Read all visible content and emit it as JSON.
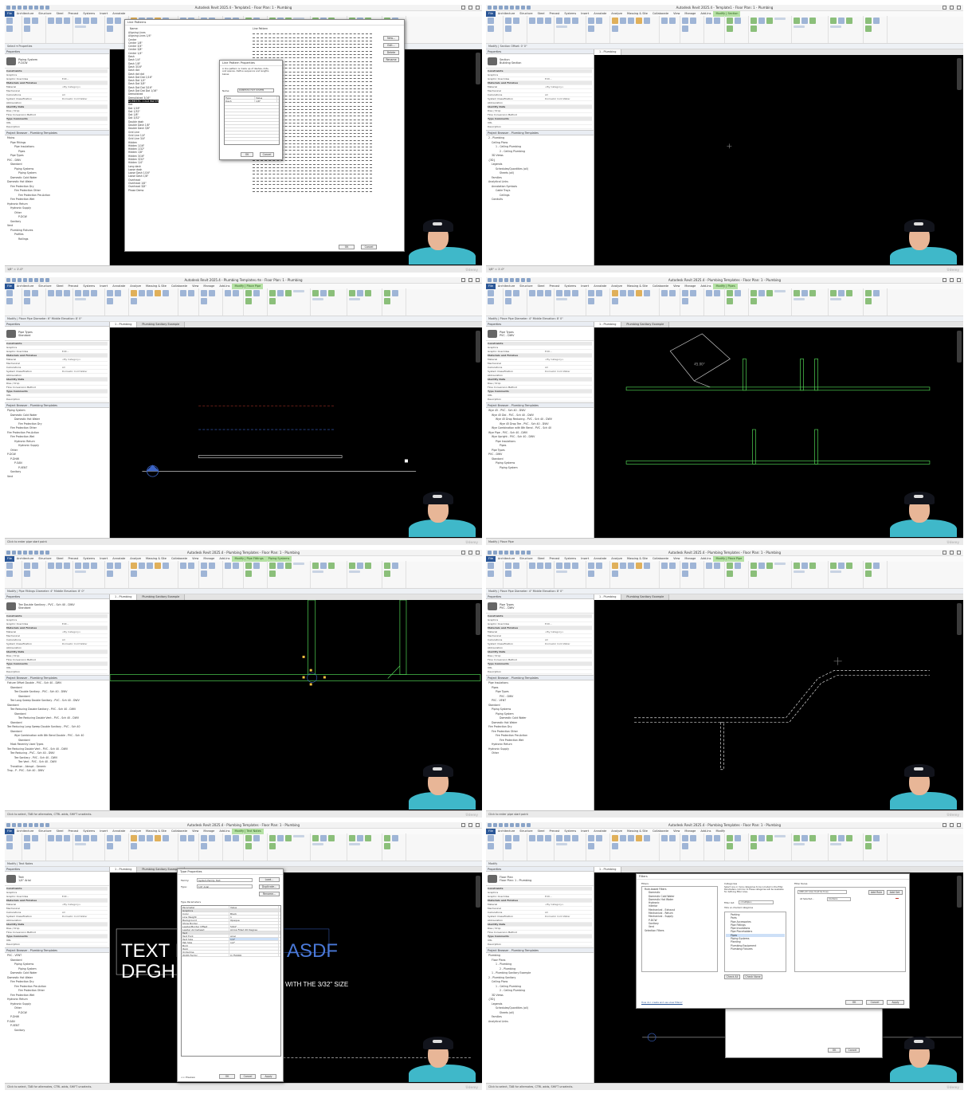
{
  "panels": [
    {
      "title": "Autodesk Revit 2025.4 - Template1 - Floor Plan: 1 - Plumbing",
      "tabs": [
        "File",
        "Architecture",
        "Structure",
        "Steel",
        "Precast",
        "Systems",
        "Insert",
        "Annotate"
      ],
      "options_bar": "Select ▾  Properties",
      "type_name": "Piping System",
      "type_sub": "P-DCW",
      "status": "1/8\" = 1'-0\"",
      "dialog_title": "Line Patterns",
      "dialog_col_name": "Name:",
      "dialog_col_pattern": "Line Pattern",
      "dialog_items": [
        "Aligning Lines",
        "Aligning Lines 1/4\"",
        "Center",
        "Center 1/8\"",
        "Center 3/4\"",
        "Center 3/8\"",
        "Center 1/4\"",
        "Dash",
        "Dash 1/4\"",
        "Dash 1/8\"",
        "Dash 3/16\"",
        "Dash dot",
        "Dash dot dot",
        "Dash Dot Dot 1/16\"",
        "Dash Dot 1/4\"",
        "Dash Dot 3/8\"",
        "Dash Dot Dot 3/16\"",
        "Dash Dot Dot Dot 1/16\"",
        "Demolished",
        "Demolished 3/16\"",
        "DOMESTIC COLD WATER",
        "Dot",
        "Dot 1/16\"",
        "Dot 1/32\"",
        "Dot 1/8\"",
        "Dot 3/32\"",
        "Double dash",
        "Double Dash 1/8\"",
        "Double Dash 3/8\"",
        "Grid Line",
        "Grid Line 1/4\"",
        "Grid Line 3/4\"",
        "Hidden",
        "Hidden 1/16\"",
        "Hidden 1/32\"",
        "Hidden 1/8\"",
        "Hidden 3/16\"",
        "Hidden 3/32\"",
        "Hidden 1/4\"",
        "Long dash",
        "Loose dash",
        "Loose Dash 1/16\"",
        "Loose Dash 1/8\"",
        "Overhead",
        "Overhead 1/8\"",
        "Overhead 3/8\"",
        "Phase Demo"
      ],
      "dialog_buttons": [
        "New...",
        "Edit...",
        "Delete",
        "Rename"
      ],
      "ok": "OK",
      "cancel": "Cancel",
      "sub_title": "Line Pattern Properties",
      "sub_text": "A line pattern is made up of dashes, dots, and spaces. Define sequence and lengths below.",
      "sub_name_label": "Name:",
      "sub_name_value": "DOMESTIC HOT SYSTEM",
      "sub_col_type": "Type",
      "sub_col_value": "Value",
      "sub_row1_type": "Dash",
      "sub_row1_value": "1/8\"",
      "tree": [
        "Mains",
        "Pipe Fittings",
        "Pipe Insulations",
        "Pipes",
        "Pipe Types",
        "PVC - DWV",
        "Standard",
        "Piping Systems",
        "Piping System",
        "Domestic Cold Water",
        "Domestic Hot Water",
        "Fire Protection Dry",
        "Fire Protection Other",
        "Fire Protection Pre-Action",
        "Fire Protection Wet",
        "Hydronic Return",
        "Hydronic Supply",
        "Other",
        "P-DCW",
        "Sanitary",
        "Vent",
        "Plumbing Fixtures",
        "Profiles",
        "Railings"
      ]
    },
    {
      "title": "Autodesk Revit 2025.4 - Template1 - Floor Plan: 1 - Plumbing",
      "tabs": [
        "File",
        "Architecture",
        "Structure",
        "Steel",
        "Precast",
        "Systems",
        "Insert",
        "Annotate",
        "Analyze",
        "Massing & Site",
        "Collaborate",
        "View",
        "Manage",
        "Add-Ins",
        "Modify | Section"
      ],
      "options_bar": "Modify | Section  Offset: 0' 0\"",
      "type_name": "Section",
      "type_sub": "Building Section",
      "status": "1/8\" = 1'-0\"",
      "view_tab": "1 - Plumbing",
      "tree": [
        "2 - Plumbing",
        "Ceiling Plans",
        "1 - Ceiling Plumbing",
        "2 - Ceiling Plumbing",
        "3D Views",
        "{3D}",
        "Legends",
        "Schedules/Quantities (all)",
        "Sheets (all)",
        "Families",
        "Analytical Links",
        "Annotation Symbols",
        "Cable Trays",
        "Ceilings",
        "Conduits"
      ]
    },
    {
      "title": "Autodesk Revit 2025.4 - Plumbing Templates.rte - Floor Plan: 1 - Plumbing",
      "tabs": [
        "File",
        "Architecture",
        "Structure",
        "Steel",
        "Precast",
        "Systems",
        "Insert",
        "Annotate",
        "Analyze",
        "Massing & Site",
        "Collaborate",
        "View",
        "Manage",
        "Add-Ins",
        "Modify | Place Pipe"
      ],
      "options_bar": "Modify | Place Pipe   Diameter: 6\"   Middle Elevation: 8' 0\"",
      "type_name": "Pipe Types",
      "type_sub": "Standard",
      "status": "Click to enter pipe start point",
      "view_tab": "1 - Plumbing",
      "view_tab2": "Plumbing Sanitary Example",
      "tree": [
        "Piping System",
        "Domestic Cold Water",
        "Domestic Hot Water",
        "Fire Protection Dry",
        "Fire Protection Other",
        "Fire Protection Pre-Action",
        "Fire Protection Wet",
        "Hydronic Return",
        "Hydronic Supply",
        "Other",
        "P-DCW",
        "P-DHW",
        "P-SAN",
        "P-VENT",
        "Sanitary",
        "Vent"
      ]
    },
    {
      "title": "Autodesk Revit 2025.4 - Plumbing Templates - Floor Plan: 1 - Plumbing",
      "tabs": [
        "File",
        "Architecture",
        "Structure",
        "Steel",
        "Precast",
        "Systems",
        "Insert",
        "Annotate",
        "Analyze",
        "Massing & Site",
        "Collaborate",
        "View",
        "Manage",
        "Add-Ins",
        "Modify | Pipes"
      ],
      "options_bar": "Modify | Place Pipe   Diameter: 4\"   Middle Elevation: 8' 0\"",
      "type_name": "Pipe Types",
      "type_sub": "PVC - DWV",
      "status": "Modify | Place Pipe",
      "view_tab": "1 - Plumbing",
      "view_tab2": "Plumbing Sanitary Example",
      "tree": [
        "Wye 45 - PVC - Sch 40 - DWV",
        "Wye 45 Dbl - PVC - Sch 40 - DWV",
        "Wye 45 Drop Reducing - PVC - Sch 40 - DWV",
        "Wye 45 Drop Tee - PVC - Sch 40 - DWV",
        "Wye Combination with 8th Bend - PVC - Sch 40",
        "Wye Pipe - PVC - Sch 40 - DWV",
        "Wye Upright - PVC - Sch 40 - DWV",
        "Pipe Insulations",
        "Pipes",
        "Pipe Types",
        "PVC - DWV",
        "Standard",
        "Piping Systems",
        "Piping System"
      ]
    },
    {
      "title": "Autodesk Revit 2025.4 - Plumbing Templates - Floor Plan: 1 - Plumbing",
      "tabs": [
        "File",
        "Architecture",
        "Structure",
        "Steel",
        "Precast",
        "Systems",
        "Insert",
        "Annotate",
        "Analyze",
        "Massing & Site",
        "Collaborate",
        "View",
        "Manage",
        "Add-Ins",
        "Modify | Pipe Fittings",
        "Piping Systems"
      ],
      "options_bar": "Modify | Pipe Fittings   Diameter: 4\"   Middle Elevation: 8' 0\"",
      "type_name": "Tee Double Sanitary - PVC - Sch 40 - DWV",
      "type_sub": "Standard",
      "status": "Click to select, TAB for alternates, CTRL adds, SHIFT unselects.",
      "view_tab": "1 - Plumbing",
      "view_tab2": "Plumbing Sanitary Example",
      "tree": [
        "Fixture Offset Double - PVC - Sch 40 - DWV",
        "Standard",
        "Tee Double Sanitary - PVC - Sch 40 - DWV",
        "Standard",
        "Tee Long Sweep Double Sanitary - PVC - Sch 40 - DWV",
        "Standard",
        "Tee Reducing Double Sanitary - PVC - Sch 40 - DWV",
        "Standard",
        "Tee Reducing Double Vent - PVC - Sch 40 - DWV",
        "Standard",
        "Tee Reducing Long Sweep Double Sanitary - PVC - Sch 40",
        "Standard",
        "Wye Combination with 8th Bend Double - PVC - Sch 40",
        "Standard",
        "Most Recently Used Types",
        "Tee Reducing Double Vent - PVC - Sch 40 - DWV",
        "Tee Reducing - PVC - Sch 40 - DWV",
        "Tee Sanitary - PVC - Sch 40 - DWV",
        "Tee Vent - PVC - Sch 40 - DWV",
        "Transition - Abrupt - Generic",
        "Trap - P - PVC - Sch 40 - DWV"
      ]
    },
    {
      "title": "Autodesk Revit 2025.4 - Plumbing Templates - Floor Plan: 1 - Plumbing",
      "tabs": [
        "File",
        "Architecture",
        "Structure",
        "Steel",
        "Precast",
        "Systems",
        "Insert",
        "Annotate",
        "Analyze",
        "Massing & Site",
        "Collaborate",
        "View",
        "Manage",
        "Add-Ins",
        "Modify | Place Pipe"
      ],
      "options_bar": "Modify | Place Pipe   Diameter: 4\"   Middle Elevation: 8' 0\"",
      "type_name": "Pipe Types",
      "type_sub": "PVC - DWV",
      "status": "Click to enter pipe start point",
      "view_tab": "1 - Plumbing",
      "view_tab2": "Plumbing Sanitary Example",
      "tree": [
        "Pipe Insulations",
        "Pipes",
        "Pipe Types",
        "PVC - DWV",
        "PVC - VENT",
        "Standard",
        "Piping Systems",
        "Piping System",
        "Domestic Cold Water",
        "Domestic Hot Water",
        "Fire Protection Dry",
        "Fire Protection Other",
        "Fire Protection Pre-Action",
        "Fire Protection Wet",
        "Hydronic Return",
        "Hydronic Supply",
        "Other"
      ]
    },
    {
      "title": "Autodesk Revit 2025.4 - Plumbing Templates - Floor Plan: 1 - Plumbing",
      "tabs": [
        "File",
        "Architecture",
        "Structure",
        "Steel",
        "Precast",
        "Systems",
        "Insert",
        "Annotate",
        "Analyze",
        "Massing & Site",
        "Collaborate",
        "View",
        "Manage",
        "Add-Ins",
        "Modify | Text Notes"
      ],
      "options_bar": "Modify | Text Notes",
      "type_name": "Text",
      "type_sub": "1/4\" Arial",
      "status": "Click to select, TAB for alternates, CTRL adds, SHIFT unselects.",
      "view_tab": "1 - Plumbing",
      "view_tab2": "Plumbing Sanitary Example",
      "text_line1": "TEXT IS",
      "text_line2": "DFGHDF",
      "text_right": "ASDF",
      "text_size_note": "WITH THE 3/32\" SIZE",
      "dialog_title": "Type Properties",
      "family_label": "Family:",
      "family_value": "System Family: Text",
      "type_label": "Type:",
      "type_value": "1/4\" Arial",
      "load_btn": "Load...",
      "dup_btn": "Duplicate...",
      "rename_btn": "Rename...",
      "type_params": "Type Parameters",
      "param_col": "Parameter",
      "value_col": "Value",
      "params": [
        [
          "Graphics",
          ""
        ],
        [
          "Color",
          "Black"
        ],
        [
          "Line Weight",
          "1"
        ],
        [
          "Background",
          "Opaque"
        ],
        [
          "Show Border",
          ""
        ],
        [
          "Leader/Border Offset",
          "5/64\""
        ],
        [
          "Leader Arrowhead",
          "Arrow Filled 20 Degree"
        ],
        [
          "Text",
          ""
        ],
        [
          "Text Font",
          "Arial"
        ],
        [
          "Text Size",
          "1/4\""
        ],
        [
          "Tab Size",
          "1/2\""
        ],
        [
          "Bold",
          ""
        ],
        [
          "Italic",
          ""
        ],
        [
          "Underline",
          ""
        ],
        [
          "Width Factor",
          "0.750000"
        ]
      ],
      "preview_btn": "<< Preview",
      "ok": "OK",
      "cancel": "Cancel",
      "apply": "Apply",
      "tree": [
        "PVC - VENT",
        "Standard",
        "Piping Systems",
        "Piping System",
        "Domestic Cold Water",
        "Domestic Hot Water",
        "Fire Protection Dry",
        "Fire Protection Pre-Action",
        "Fire Protection Other",
        "Fire Protection Wet",
        "Hydronic Return",
        "Hydronic Supply",
        "Other",
        "P-DCW",
        "P-DHW",
        "P-SAN",
        "P-VENT",
        "Sanitary"
      ]
    },
    {
      "title": "Autodesk Revit 2025.4 - Plumbing Templates - Floor Plan: 1 - Plumbing",
      "tabs": [
        "File",
        "Architecture",
        "Structure",
        "Steel",
        "Precast",
        "Systems",
        "Insert",
        "Annotate",
        "Analyze",
        "Massing & Site",
        "Collaborate",
        "View",
        "Manage",
        "Add-Ins",
        "Modify"
      ],
      "options_bar": "Modify",
      "type_name": "Floor Plan",
      "type_sub": "Floor Plan: 1 - Plumbing",
      "status": "Click to select, TAB for alternates, CTRL adds, SHIFT unselects.",
      "view_tab": "1 - Plumbing",
      "dialog_title": "Filters",
      "filters_label": "Filters",
      "filters_items": [
        "Rule-based Filters",
        "Domestic",
        "Domestic Cold Water",
        "Domestic Hot Water",
        "Hydronic",
        "Interior",
        "Mechanical - Exhaust",
        "Mechanical - Return",
        "Mechanical - Supply",
        "P-DCW",
        "Sanitary",
        "Vent",
        "Selection Filters"
      ],
      "categories_label": "Categories",
      "categories_note": "Select one or more categories to be included in the filter. Parameters common to these categories will be available for defining filter rules.",
      "filter_list_label": "Filter list:",
      "filter_list_value": "<multiple>",
      "hide_unchecked": "Hide un-checked categories",
      "category_items": [
        "Parking",
        "Parts",
        "Pipe Accessories",
        "Pipe Fittings",
        "Pipe Insulations",
        "Pipe Placeholders",
        "Pipes",
        "Piping Systems",
        "Planting",
        "Plumbing Equipment",
        "Plumbing Fixtures"
      ],
      "check_all": "Check All",
      "check_none": "Check None",
      "rules_label": "Filter Rules",
      "rules_and": "AND (All rules must be true)",
      "add_rule": "Add Rule",
      "add_set": "Add Set",
      "rule_param": "All Selected...",
      "rule_op": "Contains",
      "help_link": "How do I create and use view filters?",
      "ok": "OK",
      "cancel": "Cancel",
      "apply": "Apply",
      "vg_note": "All document filters are defined and modified here",
      "edit_new": "Edit/New...",
      "tree": [
        "Plumbing",
        "Floor Plans",
        "1 - Plumbing",
        "2 - Plumbing",
        "1 - Plumbing Sanitary Example",
        "2 - Plumbing Sanitary",
        "Ceiling Plans",
        "1 - Ceiling Plumbing",
        "2 - Ceiling Plumbing",
        "3D Views",
        "{3D}",
        "Legends",
        "Schedules/Quantities (all)",
        "Sheets (all)",
        "Families",
        "Analytical Links"
      ]
    }
  ],
  "props_generic": [
    [
      "Constraints",
      ""
    ],
    [
      "Graphics",
      ""
    ],
    [
      "Graphic Overrides",
      "Edit..."
    ],
    [
      "Materials and Finishes",
      ""
    ],
    [
      "Material",
      "<By Category>"
    ],
    [
      "Mechanical",
      ""
    ],
    [
      "Calculations",
      "All"
    ],
    [
      "System Classification",
      "Domestic Cold Water"
    ],
    [
      "Abbreviation",
      ""
    ],
    [
      "Identity Data",
      ""
    ],
    [
      "Rise / Drop",
      ""
    ],
    [
      "Flow Conversion Method",
      ""
    ],
    [
      "Type Comments",
      ""
    ],
    [
      "URL",
      ""
    ],
    [
      "Description",
      ""
    ]
  ],
  "browser_title": "Project Browser - Plumbing Templates",
  "properties_title": "Properties",
  "watermark": "Udemy",
  "colors": {
    "ribbon": "#f7f7f7",
    "canvas": "#000000",
    "pipe_green": "#4fd152",
    "pipe_dashed": "#d9d9d9",
    "accent_blue": "#2b5797",
    "highlight": "#cde0f7"
  }
}
